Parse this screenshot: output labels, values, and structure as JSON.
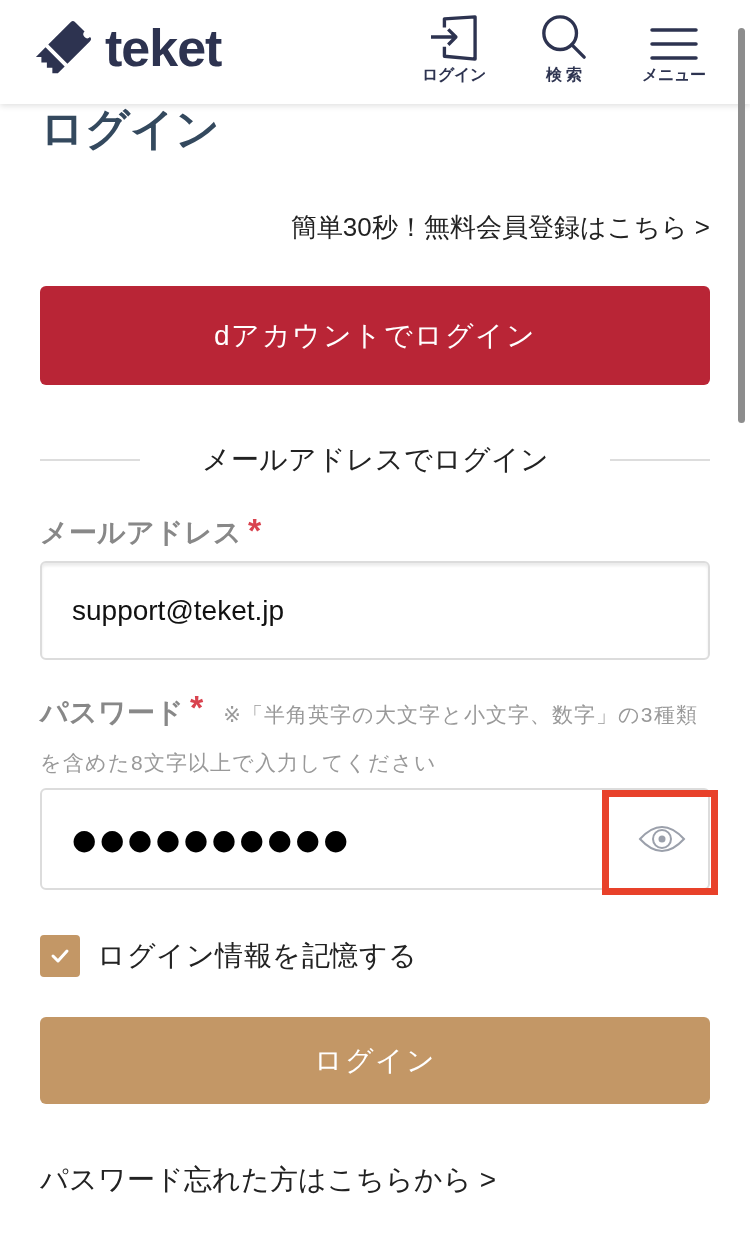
{
  "header": {
    "logo": "teket",
    "nav": [
      {
        "kind": "login",
        "label": "ログイン"
      },
      {
        "kind": "search",
        "label": "検 索"
      },
      {
        "kind": "menu",
        "label": "メニュー"
      }
    ]
  },
  "title": "ログイン",
  "register_link": "簡単30秒！無料会員登録はこちら >",
  "d_account_button": "dアカウントでログイン",
  "divider": "メールアドレスでログイン",
  "email": {
    "label": "メールアドレス",
    "required_mark": "*",
    "value": "support@teket.jp"
  },
  "password": {
    "label": "パスワード",
    "required_mark": "*",
    "note": "※「半角英字の大文字と小文字、数字」の3種類を含めた8文字以上で入力してください",
    "value": "●●●●●●●●●●",
    "toggle_highlighted": true
  },
  "remember": {
    "label": "ログイン情報を記憶する",
    "checked": true
  },
  "login_button": "ログイン",
  "forgot_link": "パスワード忘れた方はこちらから >"
}
